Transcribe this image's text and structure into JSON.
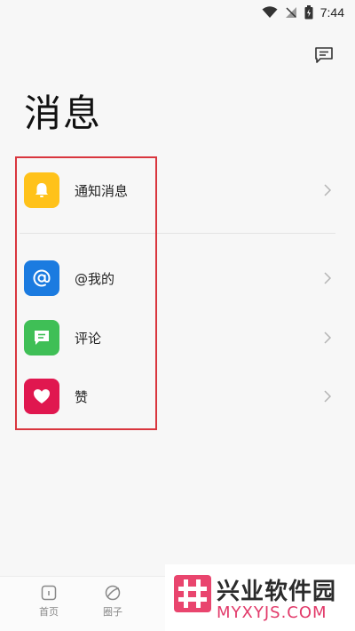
{
  "status_bar": {
    "time": "7:44"
  },
  "header": {
    "title": "消息"
  },
  "sections": [
    {
      "label": "通知消息",
      "icon": "bell-icon",
      "color": "#ffc21a"
    },
    {
      "label": "@我的",
      "icon": "at-icon",
      "color": "#1b7be0"
    },
    {
      "label": "评论",
      "icon": "comment-icon",
      "color": "#3fbf56"
    },
    {
      "label": "赞",
      "icon": "heart-icon",
      "color": "#e0174f"
    }
  ],
  "tabbar": {
    "items": [
      {
        "label": "首页",
        "icon": "home-icon"
      },
      {
        "label": "圈子",
        "icon": "circle-icon"
      }
    ]
  },
  "watermark": {
    "title": "兴业软件园",
    "subtitle": "MYXYJS.COM"
  },
  "colors": {
    "highlight": "#d9363e",
    "accent_pink": "#e23a6a"
  }
}
